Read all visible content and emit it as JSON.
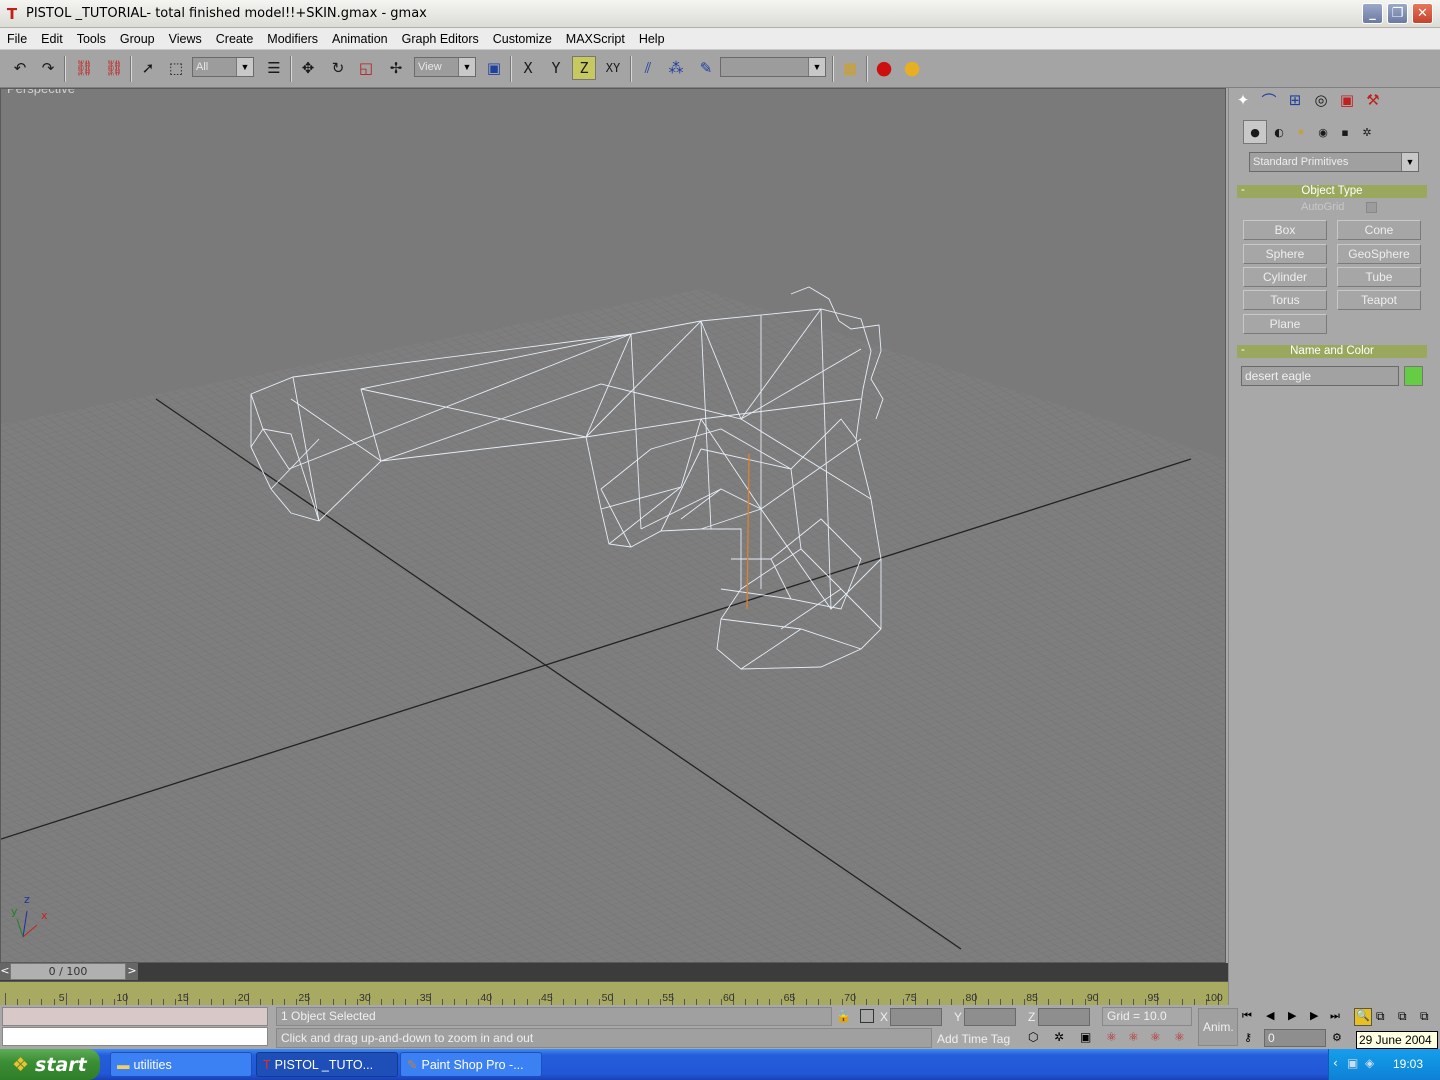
{
  "window": {
    "title": "PISTOL _TUTORIAL- total finished model!!+SKIN.gmax - gmax",
    "minimize": "_",
    "maximize": "❐",
    "close": "✕"
  },
  "menu": [
    "File",
    "Edit",
    "Tools",
    "Group",
    "Views",
    "Create",
    "Modifiers",
    "Animation",
    "Graph Editors",
    "Customize",
    "MAXScript",
    "Help"
  ],
  "toolbar": {
    "selection_filter": "All",
    "ref_coord": "View",
    "axis_x": "X",
    "axis_y": "Y",
    "axis_z": "Z",
    "axis_xy": "XY",
    "named_selection": ""
  },
  "viewport": {
    "label": "Perspective",
    "axis_x": "x",
    "axis_y": "y",
    "axis_z": "z"
  },
  "command_panel": {
    "category": "Standard Primitives",
    "object_type_title": "Object Type",
    "autogrid_label": "AutoGrid",
    "primitives": [
      "Box",
      "Cone",
      "Sphere",
      "GeoSphere",
      "Cylinder",
      "Tube",
      "Torus",
      "Teapot",
      "Plane"
    ],
    "name_color_title": "Name and Color",
    "object_name": "desert eagle",
    "object_color": "#66cc44",
    "rollout_toggle": "-"
  },
  "timeline": {
    "slider_label": "0 / 100",
    "prev": "<",
    "next": ">",
    "ruler_labels": [
      "5",
      "10",
      "15",
      "20",
      "25",
      "30",
      "35",
      "40",
      "45",
      "50",
      "55",
      "60",
      "65",
      "70",
      "75",
      "80",
      "85",
      "90",
      "95",
      "100"
    ]
  },
  "status": {
    "selection": "1 Object Selected",
    "prompt": "Click and drag up-and-down to zoom in and out",
    "x_label": "X",
    "y_label": "Y",
    "z_label": "Z",
    "grid": "Grid = 10.0",
    "add_time_tag": "Add Time Tag",
    "anim": "Anim.",
    "frame": "0"
  },
  "taskbar": {
    "start": "start",
    "tasks": [
      "utilities",
      "PISTOL _TUTO...",
      "Paint Shop Pro -..."
    ],
    "clock": "19:03",
    "date_tooltip": "29 June 2004"
  }
}
